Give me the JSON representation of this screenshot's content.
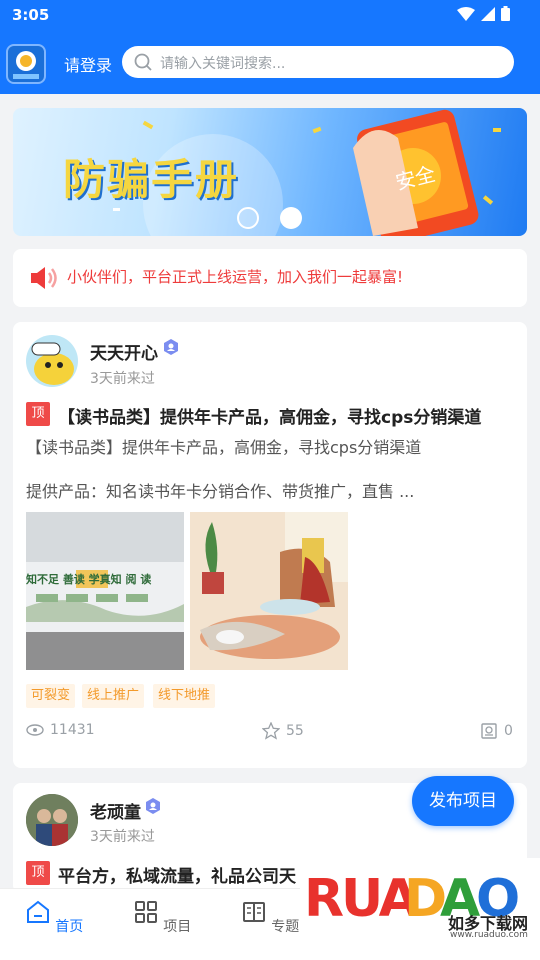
{
  "status_bar": {
    "time": "3:05"
  },
  "header": {
    "login_label": "请登录",
    "search_placeholder": "请输入关键词搜索..."
  },
  "banner": {
    "title": "防骗手册",
    "phone_text": "安全"
  },
  "notice": {
    "text": "小伙伴们，平台正式上线运营，加入我们一起暴富!"
  },
  "posts": [
    {
      "user": "天天开心",
      "time": "3天前来过",
      "badge": "顶",
      "title": "【读书品类】提供年卡产品，高佣金，寻找cps分销渠道",
      "subtitle": "【读书品类】提供年卡产品，高佣金，寻找cps分销渠道",
      "desc": "提供产品：知名读书年卡分销合作、带货推广，直售 ...",
      "tags": [
        "可裂变",
        "线上推广",
        "线下地推"
      ],
      "views": "11431",
      "likes": "55",
      "comments": "0",
      "image1_text": "知不足 善读 学真知 阅 读"
    },
    {
      "user": "老顽童",
      "time": "3天前来过",
      "badge": "顶",
      "title": "平台方，私域流量，礼品公司天"
    }
  ],
  "fab_label": "发布项目",
  "tabbar": {
    "items": [
      {
        "label": "首页"
      },
      {
        "label": "项目"
      },
      {
        "label": "专题"
      }
    ]
  },
  "watermark": {
    "brand": "RUANDAO",
    "sub": "如多下载网",
    "url": "www.ruaduo.com"
  },
  "colors": {
    "primary": "#1677ff",
    "red": "#ef4a48",
    "orange": "#f39a2b"
  }
}
